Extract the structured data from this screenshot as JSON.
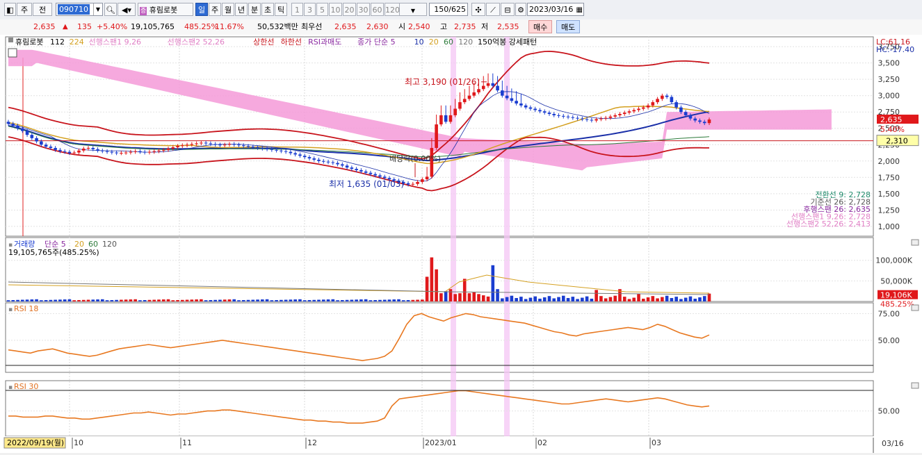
{
  "toolbar": {
    "freq_label": "주",
    "prev_label": "전",
    "code": "090710",
    "stock_name": "휴림로봇",
    "periods": [
      "일",
      "주",
      "월",
      "년",
      "분",
      "초",
      "틱"
    ],
    "selected_period": "일",
    "minutes": [
      "1",
      "3",
      "5",
      "10",
      "20",
      "30",
      "60",
      "120"
    ],
    "count": "150",
    "total": "/625",
    "date": "2023/03/16"
  },
  "quote": {
    "price": "2,635",
    "arrow": "▲",
    "change": "135",
    "change_pct": "+5.40%",
    "volume": "19,105,765",
    "volume_ratio": "485.25%",
    "turnover": "11.67%",
    "amount": "50,532백만",
    "bid_label": "최우선",
    "ask": "2,635",
    "bid": "2,630",
    "open_label": "시",
    "open": "2,540",
    "high_label": "고",
    "high": "2,735",
    "low_label": "저",
    "low": "2,535",
    "buy": "매수",
    "sell": "매도"
  },
  "legend": {
    "name": "휴림로봇",
    "p1": "112",
    "p2": "224",
    "span1": "선행스팬1 9,26",
    "span2": "선행스팬2 52,26",
    "upper": "상한선",
    "lower": "하한선",
    "rsi": "RSI과매도",
    "ma": "종가 단순 5",
    "ma10": "10",
    "ma20": "20",
    "ma60": "60",
    "ma120": "120",
    "pattern": "150억봉 강세패턴"
  },
  "right_top": {
    "lc": "LC:61.16",
    "hc": "HC:-17.40"
  },
  "ichimoku_values": [
    {
      "label": "전환선 9: 2,728",
      "color": "#1f8a6a"
    },
    {
      "label": "기준선 26: 2,728",
      "color": "#555555"
    },
    {
      "label": "후행스팬 26: 2,635",
      "color": "#8a2aa0"
    },
    {
      "label": "선행스팬1 9,26: 2,728",
      "color": "#e07fc5"
    },
    {
      "label": "선행스팬2 52,26: 2,413",
      "color": "#e07fc5"
    }
  ],
  "annotations": {
    "high": "최고 3,190 (01/26)",
    "low": "최저 1,635 (01/03)",
    "div": "배당락(0.00%)"
  },
  "price_tags": {
    "last": "2,635",
    "pct": "5.40%",
    "line": "2,310"
  },
  "volume_panel": {
    "title": "거래량",
    "ma_label": "단순 5",
    "ma20": "20",
    "ma60": "60",
    "ma120": "120",
    "summary": "19,105,765주(485.25%)",
    "tag_value": "19,106K",
    "tag_pct": "485.25%"
  },
  "rsi18": {
    "title": "RSI 18"
  },
  "rsi30": {
    "title": "RSI 30"
  },
  "x_axis": {
    "start_date": "2022/09/19(월)",
    "end_date": "03/16",
    "labels": [
      "10",
      "11",
      "12",
      "2023/01",
      "02",
      "03"
    ]
  },
  "chart_data": [
    {
      "type": "candlestick",
      "title": "휴림로봇",
      "y_ticks": [
        1000,
        1250,
        1500,
        1750,
        2000,
        2250,
        2500,
        2750,
        3000,
        3250,
        3500,
        3750
      ],
      "ylim": [
        850,
        3900
      ],
      "horizontal_line": 2310,
      "high": {
        "value": 3190,
        "date": "01/26"
      },
      "low": {
        "value": 1635,
        "date": "01/03"
      },
      "close_last": 2635,
      "closes": [
        2570,
        2540,
        2500,
        2460,
        2400,
        2350,
        2300,
        2250,
        2220,
        2200,
        2170,
        2150,
        2140,
        2120,
        2130,
        2160,
        2190,
        2200,
        2180,
        2160,
        2150,
        2140,
        2130,
        2120,
        2125,
        2130,
        2140,
        2150,
        2140,
        2130,
        2140,
        2150,
        2160,
        2170,
        2190,
        2210,
        2230,
        2240,
        2250,
        2260,
        2270,
        2280,
        2270,
        2260,
        2250,
        2240,
        2250,
        2260,
        2250,
        2240,
        2230,
        2220,
        2210,
        2200,
        2190,
        2180,
        2170,
        2160,
        2150,
        2140,
        2120,
        2100,
        2080,
        2060,
        2040,
        2020,
        2000,
        1990,
        1980,
        1970,
        1950,
        1930,
        1900,
        1880,
        1860,
        1840,
        1820,
        1800,
        1780,
        1760,
        1740,
        1720,
        1700,
        1680,
        1660,
        1640,
        1650,
        1680,
        1720,
        1760,
        2200,
        2560,
        2700,
        2600,
        2700,
        2800,
        2900,
        2950,
        3000,
        3050,
        3100,
        3150,
        3190,
        3150,
        3080,
        3000,
        2960,
        2920,
        2880,
        2850,
        2820,
        2800,
        2780,
        2760,
        2740,
        2720,
        2700,
        2690,
        2680,
        2670,
        2660,
        2650,
        2640,
        2630,
        2620,
        2640,
        2650,
        2660,
        2680,
        2700,
        2720,
        2740,
        2760,
        2780,
        2800,
        2820,
        2850,
        2900,
        2950,
        3000,
        2980,
        2900,
        2820,
        2750,
        2700,
        2650,
        2620,
        2600,
        2580,
        2635
      ]
    },
    {
      "type": "bar",
      "title": "거래량",
      "y_ticks_label": [
        "100,000K",
        "50,000K"
      ],
      "peaks": [
        {
          "date": "01/06",
          "value": 107000
        },
        {
          "date": "01/09",
          "value": 140000
        },
        {
          "date": "01/26",
          "value": 120000
        }
      ],
      "last": 19106
    },
    {
      "type": "line",
      "title": "RSI 18",
      "y_ticks": [
        50,
        75
      ],
      "values": [
        41,
        40,
        39,
        38,
        40,
        41,
        42,
        40,
        38,
        37,
        36,
        35,
        36,
        38,
        40,
        42,
        43,
        44,
        45,
        46,
        45,
        44,
        43,
        44,
        45,
        46,
        47,
        48,
        49,
        50,
        49,
        48,
        47,
        46,
        45,
        44,
        43,
        42,
        41,
        40,
        39,
        38,
        37,
        36,
        35,
        34,
        33,
        32,
        31,
        32,
        33,
        35,
        40,
        52,
        65,
        73,
        75,
        72,
        70,
        68,
        71,
        73,
        75,
        74,
        72,
        71,
        70,
        69,
        68,
        67,
        66,
        64,
        62,
        60,
        58,
        57,
        55,
        54,
        56,
        57,
        58,
        59,
        60,
        61,
        62,
        61,
        60,
        62,
        65,
        63,
        60,
        57,
        55,
        53,
        52,
        55
      ]
    },
    {
      "type": "line",
      "title": "RSI 30",
      "y_ticks": [
        50
      ],
      "values": [
        45,
        45,
        44,
        44,
        44,
        45,
        45,
        44,
        43,
        43,
        42,
        42,
        43,
        44,
        45,
        46,
        47,
        48,
        48,
        49,
        48,
        47,
        46,
        47,
        47,
        48,
        49,
        50,
        50,
        51,
        51,
        50,
        49,
        48,
        47,
        46,
        45,
        44,
        43,
        42,
        41,
        41,
        40,
        40,
        39,
        39,
        38,
        38,
        38,
        39,
        40,
        43,
        55,
        62,
        63,
        64,
        65,
        66,
        67,
        68,
        69,
        70,
        70,
        69,
        68,
        67,
        66,
        65,
        64,
        63,
        62,
        61,
        60,
        59,
        58,
        57,
        57,
        58,
        59,
        60,
        61,
        62,
        61,
        60,
        59,
        60,
        61,
        62,
        63,
        62,
        60,
        58,
        56,
        55,
        54,
        55
      ]
    }
  ]
}
